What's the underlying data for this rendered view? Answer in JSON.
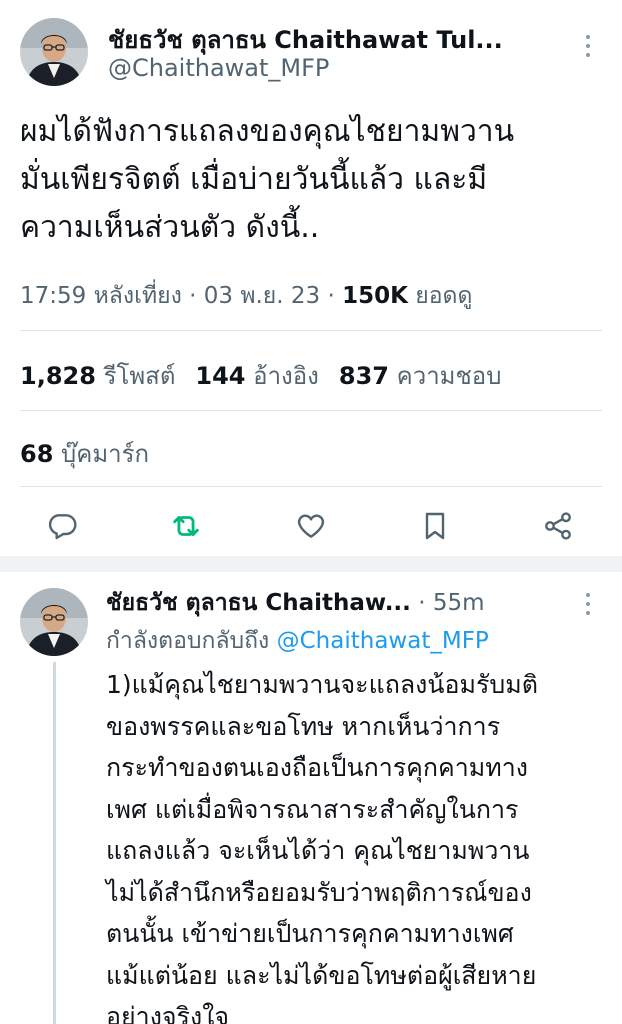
{
  "main_tweet": {
    "author_name": "ชัยธวัช ตุลาธน Chaithawat Tul...",
    "author_handle": "@Chaithawat_MFP",
    "text": "ผมได้ฟังการแถลงของคุณไชยามพวาน\nมั่นเพียรจิตต์ เมื่อบ่ายวันนี้แล้ว และมี\nความเห็นส่วนตัว ดังนี้..",
    "time": "17:59 หลังเที่ยง",
    "date": "03 พ.ย. 23",
    "views_count": "150K",
    "views_label": "ยอดดู",
    "retweets_count": "1,828",
    "retweets_label": "รีโพสต์",
    "quotes_count": "144",
    "quotes_label": "อ้างอิง",
    "likes_count": "837",
    "likes_label": "ความชอบ",
    "bookmarks_count": "68",
    "bookmarks_label": "บุ๊คมาร์ก"
  },
  "actions": {
    "reply_icon": "speech-bubble-icon",
    "retweet_icon": "retweet-icon",
    "retweet_color": "#00ba7c",
    "like_icon": "heart-icon",
    "bookmark_icon": "bookmark-icon",
    "share_icon": "share-icon"
  },
  "reply_tweet": {
    "author_name": "ชัยธวัช ตุลาธน Chaithaw...",
    "dot": "·",
    "time_ago": "55m",
    "replying_to_label": "กำลังตอบกลับถึง",
    "replying_to_handle": "@Chaithawat_MFP",
    "text": "1)แม้คุณไชยามพวานจะแถลงน้อมรับมติ\nของพรรคและขอโทษ หากเห็นว่าการ\nกระทำของตนเองถือเป็นการคุกคามทาง\nเพศ แต่เมื่อพิจารณาสาระสำคัญในการ\nแถลงแล้ว จะเห็นได้ว่า คุณไชยามพวาน\nไม่ได้สำนึกหรือยอมรับว่าพฤติการณ์ของ\nตนนั้น เข้าข่ายเป็นการคุกคามทางเพศ\nแม้แต่น้อย และไม่ได้ขอโทษต่อผู้เสียหาย\nอย่างจริงใจ"
  },
  "colors": {
    "text": "#0f1419",
    "secondary": "#536471",
    "link": "#1d9bf0",
    "retweet_green": "#00ba7c",
    "divider": "#dfe3e6"
  }
}
